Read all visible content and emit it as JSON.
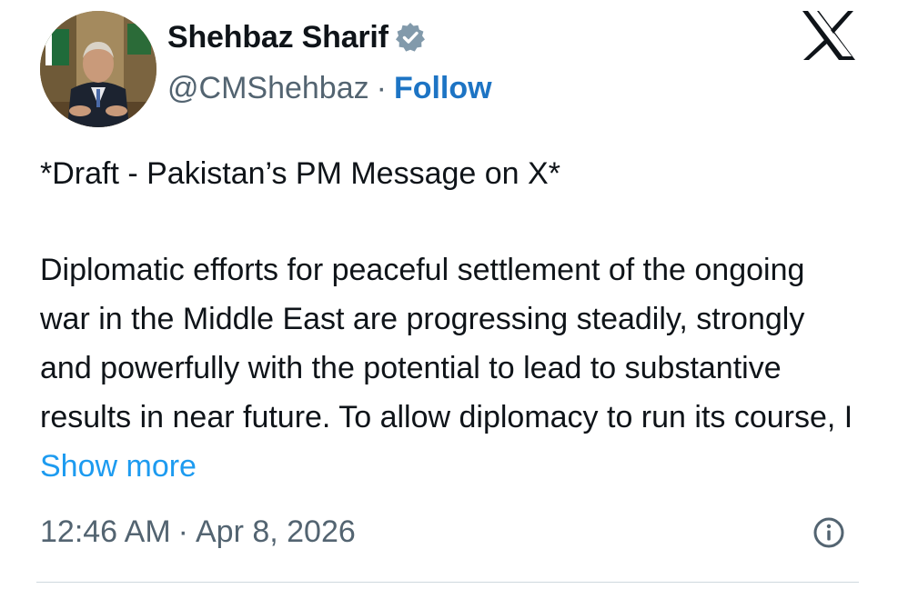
{
  "author": {
    "display_name": "Shehbaz Sharif",
    "handle": "@CMShehbaz",
    "separator": "·",
    "follow_label": "Follow",
    "verified_icon": "verified-badge-icon",
    "avatar": "avatar-photo"
  },
  "brand": {
    "logo_icon": "x-logo-icon"
  },
  "tweet": {
    "draft_line": "*Draft - Pakistan’s PM Message on X*",
    "body_text": "Diplomatic efforts for peaceful settlement of the ongoing war in the Middle East are progressing steadily, strongly and powerfully with the potential to lead to substantive results in near future. To allow diplomacy to run its course, I ",
    "show_more_label": "Show more"
  },
  "meta": {
    "time": "12:46 AM",
    "separator": "·",
    "date": "Apr 8, 2026",
    "info_icon": "info-icon"
  },
  "colors": {
    "text": "#0f1419",
    "secondary": "#536471",
    "link": "#1d9bf0",
    "follow": "#1d74c4",
    "divider": "#cfd9de"
  }
}
